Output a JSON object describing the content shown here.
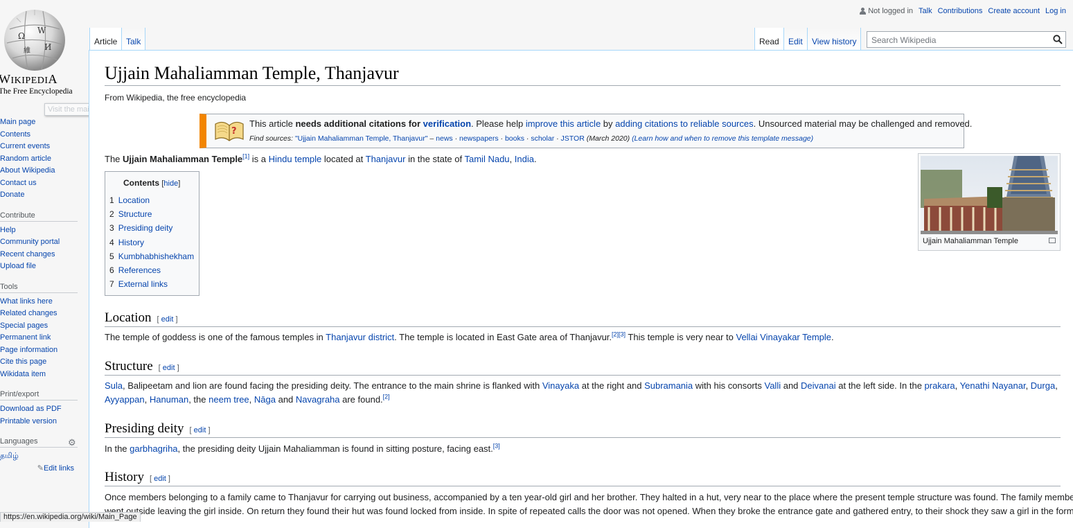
{
  "logo": {
    "wordmark": "Wikipedia",
    "tagline": "The Free Encyclopedia"
  },
  "tooltip": "Visit the main page",
  "sidebar": {
    "navigation": [
      "Main page",
      "Contents",
      "Current events",
      "Random article",
      "About Wikipedia",
      "Contact us",
      "Donate"
    ],
    "contribute": {
      "title": "Contribute",
      "items": [
        "Help",
        "Community portal",
        "Recent changes",
        "Upload file"
      ]
    },
    "tools": {
      "title": "Tools",
      "items": [
        "What links here",
        "Related changes",
        "Special pages",
        "Permanent link",
        "Page information",
        "Cite this page",
        "Wikidata item"
      ]
    },
    "print": {
      "title": "Print/export",
      "items": [
        "Download as PDF",
        "Printable version"
      ]
    },
    "languages": {
      "title": "Languages",
      "items": [
        "தமிழ்"
      ],
      "edit_links": "Edit links"
    }
  },
  "personal": {
    "not_logged_in": "Not logged in",
    "talk": "Talk",
    "contributions": "Contributions",
    "create_account": "Create account",
    "log_in": "Log in"
  },
  "tabs": {
    "article": "Article",
    "talk": "Talk",
    "read": "Read",
    "edit": "Edit",
    "view_history": "View history"
  },
  "search": {
    "placeholder": "Search Wikipedia"
  },
  "page": {
    "title": "Ujjain Mahaliamman Temple, Thanjavur",
    "sitesub": "From Wikipedia, the free encyclopedia"
  },
  "ambox": {
    "t1": "This article ",
    "t2": "needs additional citations for ",
    "t3": "verification",
    "t4": ". Please help ",
    "t5": "improve this article",
    "t6": " by ",
    "t7": "adding citations to reliable sources",
    "t8": ". Unsourced material may be challenged and removed.",
    "find_label": "Find sources: ",
    "find_query": "\"Ujjain Mahaliamman Temple, Thanjavur\"",
    "find_sep": " – ",
    "find_links": [
      "news",
      "newspapers",
      "books",
      "scholar",
      "JSTOR"
    ],
    "find_date": " (March 2020) ",
    "find_learn": "(Learn how and when to remove this template message)"
  },
  "intro": {
    "a": "The ",
    "b": "Ujjain Mahaliamman Temple",
    "ref": "[1]",
    "c": " is a ",
    "hindu": "Hindu",
    "d": " ",
    "temple": "temple",
    "e": " located at ",
    "thanjavur": "Thanjavur",
    "f": " in the state of ",
    "tn": "Tamil Nadu",
    "g": ", ",
    "india": "India",
    "h": "."
  },
  "toc": {
    "title": "Contents",
    "hide": "hide",
    "items": [
      {
        "num": "1",
        "label": "Location"
      },
      {
        "num": "2",
        "label": "Structure"
      },
      {
        "num": "3",
        "label": "Presiding deity"
      },
      {
        "num": "4",
        "label": "History"
      },
      {
        "num": "5",
        "label": "Kumbhabhishekham"
      },
      {
        "num": "6",
        "label": "References"
      },
      {
        "num": "7",
        "label": "External links"
      }
    ]
  },
  "thumb": {
    "caption": "Ujjain Mahaliamman Temple"
  },
  "sections": {
    "edit_label": "edit",
    "location": {
      "title": "Location",
      "a": "The temple of goddess is one of the famous temples in ",
      "l1": "Thanjavur district",
      "b": ". The temple is located in East Gate area of Thanjavur.",
      "ref": "[2][3]",
      "c": " This temple is very near to ",
      "l2": "Vellai Vinayakar Temple",
      "d": "."
    },
    "structure": {
      "title": "Structure",
      "sula": "Sula",
      "a": ", Balipeetam and lion are found facing the presiding deity. The entrance to the main shrine is flanked with ",
      "vinayaka": "Vinayaka",
      "b": " at the right and ",
      "subramania": "Subramania",
      "c": " with his consorts ",
      "valli": "Valli",
      "d": " and ",
      "deivanai": "Deivanai",
      "e": " at the left side. In the ",
      "prakara": "prakara",
      "f": ", ",
      "yenathi": "Yenathi Nayanar",
      "g": ", ",
      "durga": "Durga",
      "h": ",",
      "ayyappan": "Ayyappan",
      "i": ", ",
      "hanuman": "Hanuman",
      "j": ", the ",
      "neem": "neem tree",
      "k": ", ",
      "naga": "Nāga",
      "l": " and ",
      "navagraha": "Navagraha",
      "m": " are found.",
      "ref": "[2]"
    },
    "deity": {
      "title": "Presiding deity",
      "a": "In the ",
      "garbha": "garbhagriha",
      "b": ", the presiding deity Ujjain Mahaliamman is found in sitting posture, facing east.",
      "ref": "[3]"
    },
    "history": {
      "title": "History",
      "line1": "Once members belonging to a family came to Thanjavur for carrying out business, accompanied by a ten year-old girl and her brother. They halted in a hut, very near to the place where the present temple structure was found. The family members",
      "line2": "went outside leaving the girl inside. On return they found their hut was found locked from inside. In spite of repeated calls the door was not opened. When they broke the entrance gate and gathered entry, to their shock they saw a girl in the form of"
    }
  },
  "statusbar": "https://en.wikipedia.org/wiki/Main_Page",
  "colors": {
    "link": "#0645ad",
    "tab_border": "#a7d7f9",
    "ambox_bar": "#f28500"
  }
}
